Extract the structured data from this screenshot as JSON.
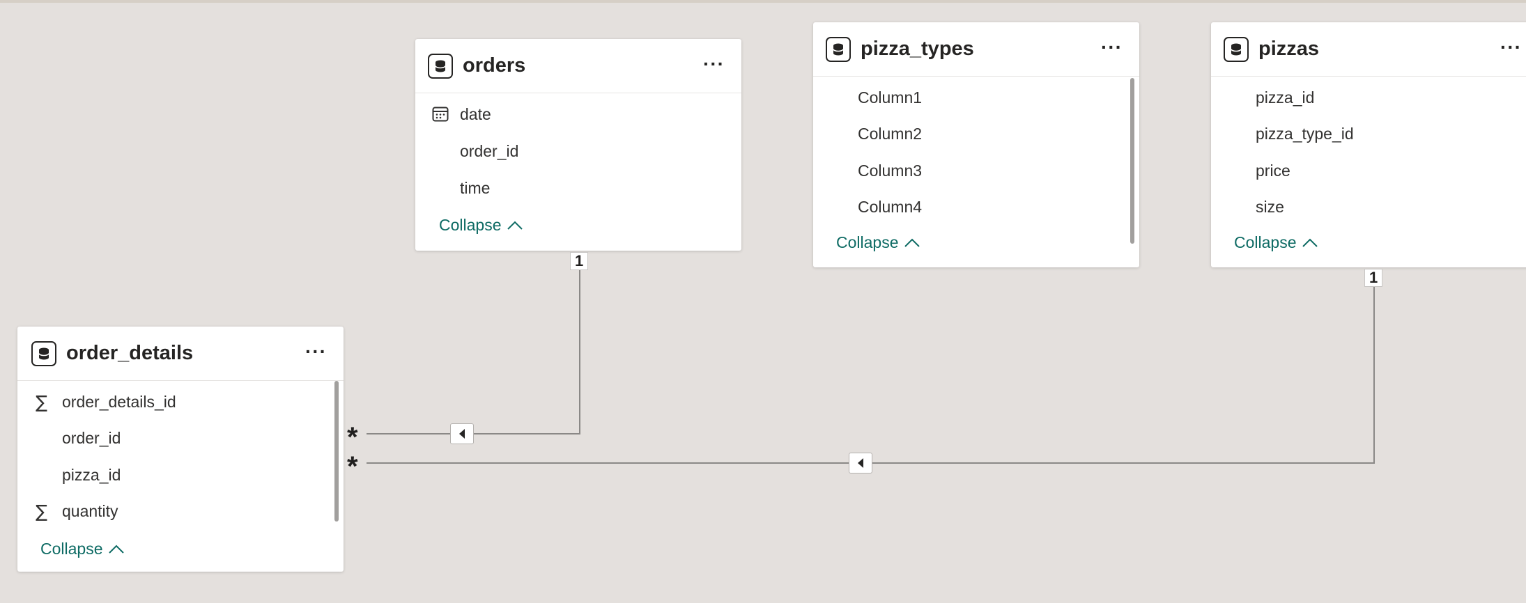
{
  "tables": {
    "orders": {
      "name": "orders",
      "fields": [
        "date",
        "order_id",
        "time"
      ],
      "collapse_label": "Collapse"
    },
    "pizza_types": {
      "name": "pizza_types",
      "fields": [
        "Column1",
        "Column2",
        "Column3",
        "Column4"
      ],
      "collapse_label": "Collapse"
    },
    "pizzas": {
      "name": "pizzas",
      "fields": [
        "pizza_id",
        "pizza_type_id",
        "price",
        "size"
      ],
      "collapse_label": "Collapse"
    },
    "order_details": {
      "name": "order_details",
      "fields": [
        "order_details_id",
        "order_id",
        "pizza_id",
        "quantity"
      ],
      "collapse_label": "Collapse"
    }
  },
  "more_label": "···",
  "relationships": {
    "orders_to_order_details": {
      "one_side": "1",
      "many_side": "*"
    },
    "pizzas_to_order_details": {
      "one_side": "1",
      "many_side": "*"
    }
  },
  "colors": {
    "canvas": "#e4e0dd",
    "card": "#ffffff",
    "collapse_link": "#0e6b64",
    "relationship_line": "#8a8886"
  },
  "icons": {
    "table": "table-icon",
    "date_field": "calendar-icon",
    "sum_field": "sigma-icon",
    "more": "more-options-icon",
    "collapse": "chevron-up-icon",
    "filter_direction": "caret-left-icon"
  }
}
